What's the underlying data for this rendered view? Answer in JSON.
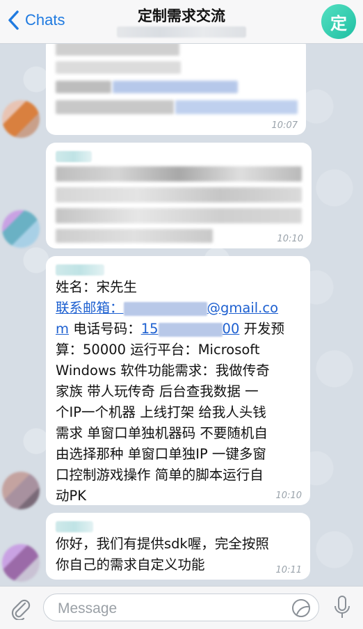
{
  "header": {
    "back_label": "Chats",
    "title": "定制需求交流",
    "avatar_letter": "定"
  },
  "messages": [
    {
      "time": "10:07"
    },
    {
      "time": "10:10"
    },
    {
      "time": "10:10",
      "line1": "姓名：宋先生",
      "email_label": "联系邮箱：",
      "email_domain": "@gmail.co",
      "email_tail": "m",
      "phone_label": " 电话号码：",
      "phone_start": "15",
      "phone_end": "00",
      "rest_line2": " 开发预",
      "line3": "算：50000 运行平台：Microsoft",
      "line4": "Windows 软件功能需求：我做传奇",
      "line5": "家族 带人玩传奇 后台查我数据 一",
      "line6": "个IP一个机器 上线打架 给我人头钱",
      "line7": "需求 单窗口单独机器码 不要随机自",
      "line8": "由选择那种 单窗口单独IP 一键多窗",
      "line9": "口控制游戏操作 简单的脚本运行自",
      "line10": "动PK"
    },
    {
      "time": "10:11",
      "line1": "你好，我们有提供sdk喔，完全按照",
      "line2": "你自己的需求自定义功能"
    }
  ],
  "input": {
    "placeholder": "Message"
  }
}
